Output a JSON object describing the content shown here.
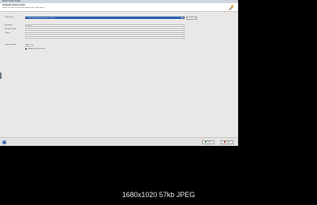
{
  "window": {
    "title": "MeGUI Script Creator"
  },
  "header": {
    "title": "AviSynth Script Creator",
    "subtitle": "Select the source video and configure the script options"
  },
  "form": {
    "video_label": "Video Input",
    "video_value": "I:\\videos\\capture\\sample_clip_01.mpg",
    "browse_label": "...",
    "field2_label": "Encoding",
    "field2_value": "MPG",
    "field3_label": "Encoder Profile",
    "field4_label": "Output",
    "field5_label": "",
    "option_label": "Output Threads",
    "option_value": "4",
    "check_label": "Apply settings to all files"
  },
  "footer": {
    "help": "?",
    "ok_label": "Save",
    "cancel_label": "Close"
  },
  "caption": {
    "text": "1680x1020  57kb  JPEG"
  }
}
